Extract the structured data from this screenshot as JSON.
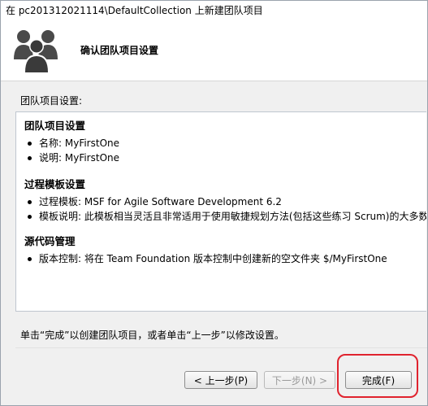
{
  "window": {
    "title": "在 pc201312021114\\DefaultCollection 上新建团队项目"
  },
  "banner": {
    "title": "确认团队项目设置",
    "icon": "team-people-icon"
  },
  "section_label": "团队项目设置:",
  "groups": [
    {
      "heading": "团队项目设置",
      "items": [
        "名称: MyFirstOne",
        "说明: MyFirstOne"
      ]
    },
    {
      "heading": "过程模板设置",
      "items": [
        "过程模板: MSF for Agile Software Development 6.2",
        "模板说明: 此模板相当灵活且非常适用于使用敏捷规划方法(包括这些练习  Scrum)的大多数"
      ]
    },
    {
      "heading": "源代码管理",
      "items": [
        "版本控制: 将在  Team Foundation 版本控制中创建新的空文件夹  $/MyFirstOne"
      ]
    }
  ],
  "hint": "单击“完成”以创建团队项目，或者单击“上一步”以修改设置。",
  "buttons": {
    "back": "< 上一步(P)",
    "next": "下一步(N) >",
    "finish": "完成(F)"
  },
  "colors": {
    "highlight": "#e0232e"
  }
}
